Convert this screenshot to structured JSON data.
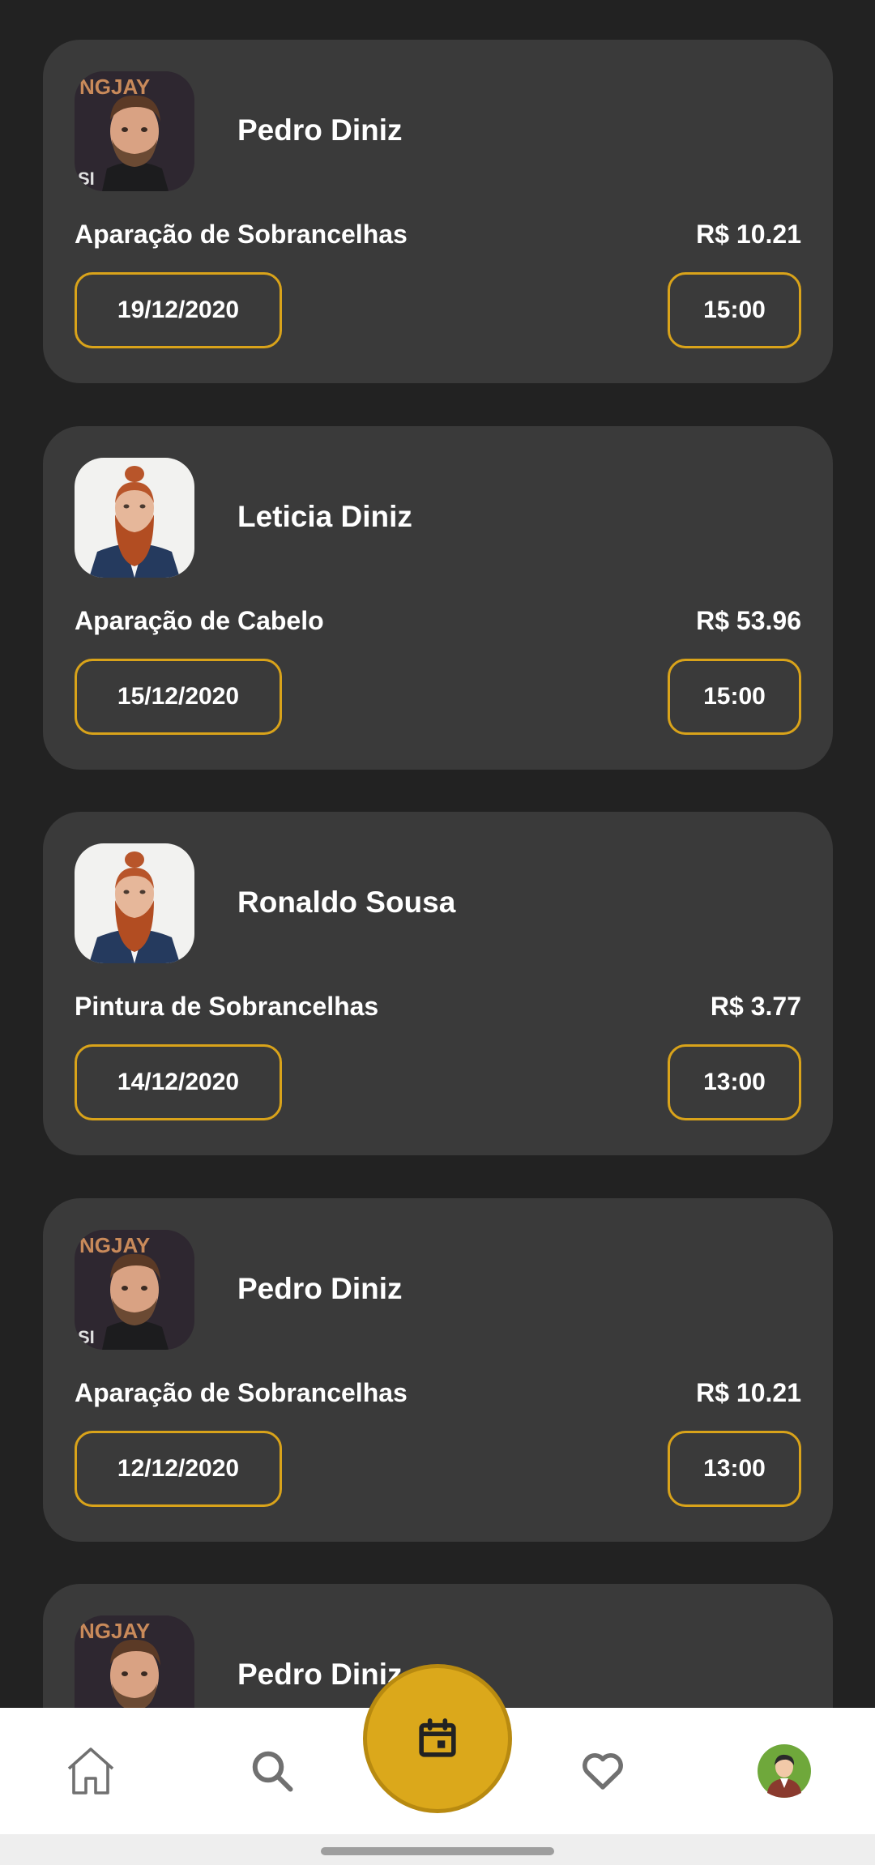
{
  "appointments": [
    {
      "name": "Pedro Diniz",
      "service": "Aparação de Sobrancelhas",
      "price": "R$ 10.21",
      "date": "19/12/2020",
      "time": "15:00",
      "avatar": "man-brown-hair-photo"
    },
    {
      "name": "Leticia Diniz",
      "service": "Aparação de Cabelo",
      "price": "R$ 53.96",
      "date": "15/12/2020",
      "time": "15:00",
      "avatar": "man-red-beard-photo"
    },
    {
      "name": "Ronaldo Sousa",
      "service": "Pintura de Sobrancelhas",
      "price": "R$ 3.77",
      "date": "14/12/2020",
      "time": "13:00",
      "avatar": "man-red-beard-photo"
    },
    {
      "name": "Pedro Diniz",
      "service": "Aparação de Sobrancelhas",
      "price": "R$ 10.21",
      "date": "12/12/2020",
      "time": "13:00",
      "avatar": "man-brown-hair-photo"
    },
    {
      "name": "Pedro Diniz",
      "service": "",
      "price": "",
      "date": "",
      "time": "",
      "avatar": "man-brown-hair-photo"
    }
  ],
  "nav": {
    "items": [
      {
        "icon": "home-icon"
      },
      {
        "icon": "search-icon"
      },
      {
        "icon": "calendar-icon",
        "active": true
      },
      {
        "icon": "heart-icon"
      },
      {
        "icon": "profile-avatar"
      }
    ]
  },
  "colors": {
    "background": "#222222",
    "card": "#3a3a3a",
    "accent": "#dba81b",
    "navbar": "#ffffff"
  }
}
